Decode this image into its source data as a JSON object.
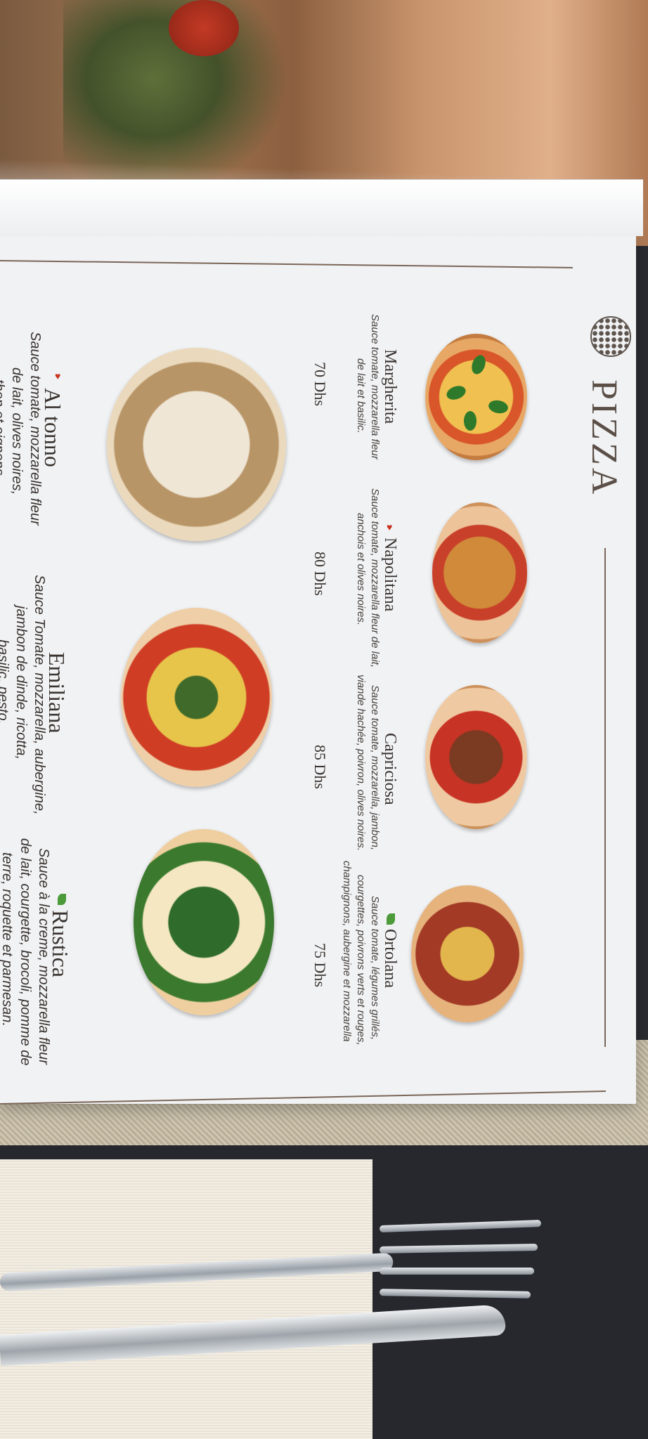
{
  "menu": {
    "title": "PIZZA",
    "items": [
      {
        "name": "Margherita",
        "desc1": "Sauce tomate, mozzarella fleur",
        "desc2": "de lait et basilic.",
        "price": "70 Dhs"
      },
      {
        "name": "Napolitana",
        "desc1": "Sauce tomate, mozzarella fleur de lait,",
        "desc2": "anchois et olives noires.",
        "price": "80 Dhs"
      },
      {
        "name": "Capriciosa",
        "desc1": "Sauce tomate, mozzarella, jambon,",
        "desc2": "viande hachée, poivron, olives noires.",
        "price": "85 Dhs"
      },
      {
        "name": "Ortolana",
        "desc1": "Sauce tomate, légumes grillés,",
        "desc2": "courgettes, poivrons verts et rouges,",
        "desc3": "champignons, aubergine et mozzarella",
        "price": "75 Dhs"
      },
      {
        "name": "Al tonno",
        "desc1": "Sauce tomate, mozzarella fleur",
        "desc2": "de lait, olives noires,",
        "desc3": "thon et oignons"
      },
      {
        "name": "Emiliana",
        "desc1": "Sauce Tomate, mozzarella, aubergine,",
        "desc2": "jambon de dinde, ricotta,",
        "desc3": "basilic, pesto."
      },
      {
        "name": "Rustica",
        "desc1": "Sauce à la creme, mozzarella fleur",
        "desc2": "de lait, courgette, brocoli, pomme de",
        "desc3": "terre, roquette et parmesan."
      }
    ]
  }
}
